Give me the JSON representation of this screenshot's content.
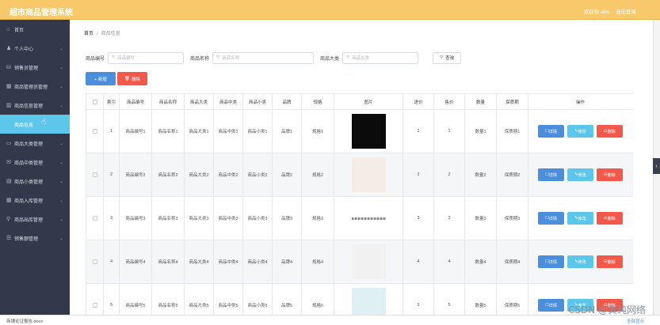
{
  "app": {
    "title": "超市商品管理系统",
    "welcome": "欢迎你 abo",
    "logout": "退出登录"
  },
  "sidebar": {
    "items": [
      {
        "label": "首页",
        "icon": "home-icon",
        "chevron": ""
      },
      {
        "label": "个人中心",
        "icon": "user-icon",
        "chevron": "⌄"
      },
      {
        "label": "销售员管理",
        "icon": "chart-icon",
        "chevron": "⌄"
      },
      {
        "label": "商品管理员管理",
        "icon": "grid-icon",
        "chevron": "⌄"
      },
      {
        "label": "商品信息管理",
        "icon": "bar-icon",
        "chevron": "⌄"
      },
      {
        "label": "商品信息",
        "icon": "",
        "chevron": "",
        "sub": true,
        "active": true
      },
      {
        "label": "商品大类管理",
        "icon": "folder-icon",
        "chevron": "⌄"
      },
      {
        "label": "商品中类管理",
        "icon": "mail-icon",
        "chevron": "⌄"
      },
      {
        "label": "商品小类管理",
        "icon": "doc-icon",
        "chevron": "⌄"
      },
      {
        "label": "商品入库管理",
        "icon": "table-icon",
        "chevron": "⌄"
      },
      {
        "label": "商品出库管理",
        "icon": "pin-icon",
        "chevron": "⌄"
      },
      {
        "label": "销售额管理",
        "icon": "list-icon",
        "chevron": "⌄"
      }
    ]
  },
  "breadcrumb": {
    "home": "首页",
    "sep": "/",
    "current": "商品信息"
  },
  "search": {
    "fields": [
      {
        "label": "商品编号",
        "placeholder": "商品编号"
      },
      {
        "label": "商品名称",
        "placeholder": "商品名称"
      },
      {
        "label": "商品大类",
        "placeholder": "商品大类"
      }
    ],
    "query": "查询"
  },
  "actions": {
    "add": "+ 新增",
    "delete": "删除"
  },
  "table": {
    "headers": [
      "",
      "索引",
      "商品编号",
      "商品名称",
      "商品大类",
      "商品中类",
      "商品小类",
      "品牌",
      "规格",
      "图片",
      "进价",
      "售价",
      "数量",
      "保质期",
      "操作"
    ],
    "rows": [
      {
        "idx": "1",
        "code": "商品编号1",
        "name": "商品名称1",
        "big": "商品大类1",
        "mid": "商品中类1",
        "small": "商品小类1",
        "brand": "品牌1",
        "spec": "规格1",
        "img": "can",
        "buy": "1",
        "sell": "1",
        "qty": "数量1",
        "shelf": "保质期1"
      },
      {
        "idx": "2",
        "code": "商品编号2",
        "name": "商品名称2",
        "big": "商品大类2",
        "mid": "商品中类2",
        "small": "商品小类2",
        "brand": "品牌2",
        "spec": "规格2",
        "img": "lip",
        "buy": "2",
        "sell": "2",
        "qty": "数量2",
        "shelf": "保质期2"
      },
      {
        "idx": "3",
        "code": "商品编号3",
        "name": "商品名称3",
        "big": "商品大类3",
        "mid": "商品中类3",
        "small": "商品小类3",
        "brand": "品牌3",
        "spec": "规格3",
        "img": "line",
        "buy": "3",
        "sell": "3",
        "qty": "数量3",
        "shelf": "保质期3"
      },
      {
        "idx": "4",
        "code": "商品编号4",
        "name": "商品名称4",
        "big": "商品大类4",
        "mid": "商品中类4",
        "small": "商品小类4",
        "brand": "品牌4",
        "spec": "规格4",
        "img": "bag",
        "buy": "4",
        "sell": "4",
        "qty": "数量4",
        "shelf": "保质期4"
      },
      {
        "idx": "5",
        "code": "商品编号5",
        "name": "商品名称5",
        "big": "商品大类5",
        "mid": "商品中类5",
        "small": "商品小类5",
        "brand": "品牌5",
        "spec": "规格5",
        "img": "bottles",
        "buy": "5",
        "sell": "5",
        "qty": "数量5",
        "shelf": "保质期5"
      }
    ],
    "ops": {
      "detail": "详情",
      "edit": "修改",
      "delete": "删除"
    }
  },
  "bottom": {
    "file": "商铺论证报告.docx",
    "show_all": "全部显示"
  },
  "watermark": "CSDN @真纯网络",
  "colors": {
    "topbar": "#f7c96a",
    "sidebar": "#33394a",
    "active": "#5cc7ea",
    "primary": "#4a8fdc",
    "danger": "#f4584a"
  }
}
